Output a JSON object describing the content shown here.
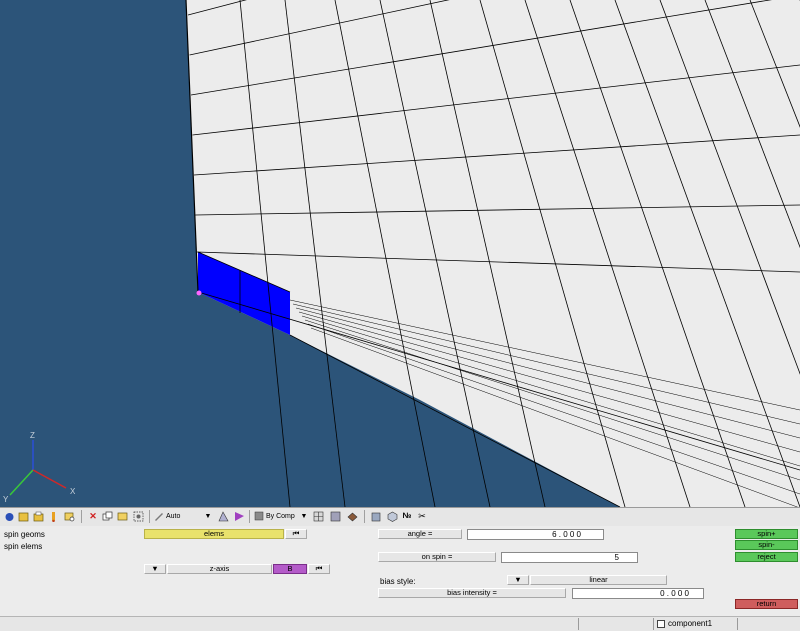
{
  "viewport": {
    "colors": {
      "background": "#2c5479",
      "mesh_face": "#ececec",
      "mesh_line": "#000000",
      "selected_elems": "#0000ff",
      "node_marker": "#ff66ff"
    },
    "axis_triad": {
      "z": "Z",
      "y": "Y",
      "x": "X"
    }
  },
  "toolbar": {
    "icons": [
      "open-icon",
      "save-icon",
      "import-icon",
      "info-icon",
      "find-icon",
      "delete-icon",
      "copy-icon",
      "organize-icon",
      "mask-icon"
    ],
    "display_mode": "Auto",
    "color_mode": "By Comp",
    "view_icons": [
      "wireframe-icon",
      "shaded-icon",
      "shaded-edges-icon",
      "box-icon",
      "cube-icon",
      "numbers-icon",
      "scissors-icon"
    ]
  },
  "panel": {
    "left_labels": [
      "spin geoms",
      "spin elems"
    ],
    "elems_button": "elems",
    "axis_button": "z-axis",
    "b_button": "B",
    "angle_label": "angle =",
    "angle_value": "6 . 0 0 0",
    "on_spin_label": "on spin =",
    "on_spin_value": "5",
    "bias_style_label": "bias style:",
    "bias_style_value": "linear",
    "bias_intensity_label": "bias intensity =",
    "bias_intensity_value": "0 . 0 0 0",
    "spin_plus": "spin+",
    "spin_minus": "spin-",
    "reject": "reject",
    "return": "return"
  },
  "statusbar": {
    "component": "component1"
  }
}
